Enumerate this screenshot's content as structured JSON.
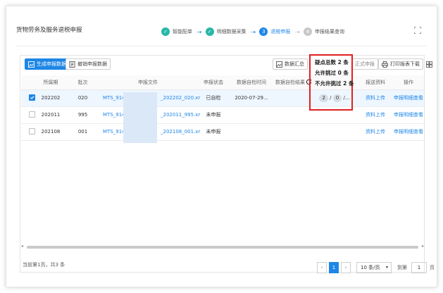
{
  "header": {
    "title": "货物劳务及服务退税申报",
    "steps": [
      {
        "label": "智能配单",
        "state": "done",
        "num": ""
      },
      {
        "label": "明细数据采集",
        "state": "done",
        "num": ""
      },
      {
        "label": "退税申报",
        "state": "active",
        "num": "3"
      },
      {
        "label": "申报结果查询",
        "state": "todo",
        "num": "4"
      }
    ],
    "arrow": "----▸"
  },
  "toolbar": {
    "generate": "生成申报数据",
    "cancel": "撤销申报数据",
    "summary": "数据汇总",
    "formal": "正式申报",
    "print": "打印报表下载"
  },
  "popup": {
    "line1": "疑点总数 2 条",
    "line2": "允许挑过 0 条",
    "line3": "不允许挑过 2 条"
  },
  "table": {
    "headers": [
      "所属期",
      "批次",
      "申报文件",
      "申报状态",
      "数据自检时间",
      "数据自检结果",
      "报送资料",
      "操作"
    ],
    "rows": [
      {
        "period": "202202",
        "batch": "020",
        "file_a": "MTS_914",
        "file_b": "_202202_020.xr",
        "status": "已自检",
        "time": "2020-07-29...",
        "result": {
          "a": "2",
          "b": "0",
          "c": "/..."
        },
        "docs": "资料上传",
        "op": "申报明细查看",
        "checked": true
      },
      {
        "period": "202011",
        "batch": "995",
        "file_a": "MTS_914",
        "file_b": "_202011_995.xr",
        "status": "未申报",
        "time": "",
        "result": null,
        "docs": "资料上传",
        "op": "申报明细查看",
        "checked": false
      },
      {
        "period": "202108",
        "batch": "001",
        "file_a": "MTS_914",
        "file_b": "_202108_001.xr",
        "status": "未申报",
        "time": "",
        "result": null,
        "docs": "资料上传",
        "op": "申报明细查看",
        "checked": false
      }
    ]
  },
  "footer": {
    "summary": "当前第1页，共3 条",
    "current_page": "1",
    "page_size": "10 条/页",
    "goto_label": "到第",
    "goto_value": "1",
    "goto_suffix": "页"
  }
}
